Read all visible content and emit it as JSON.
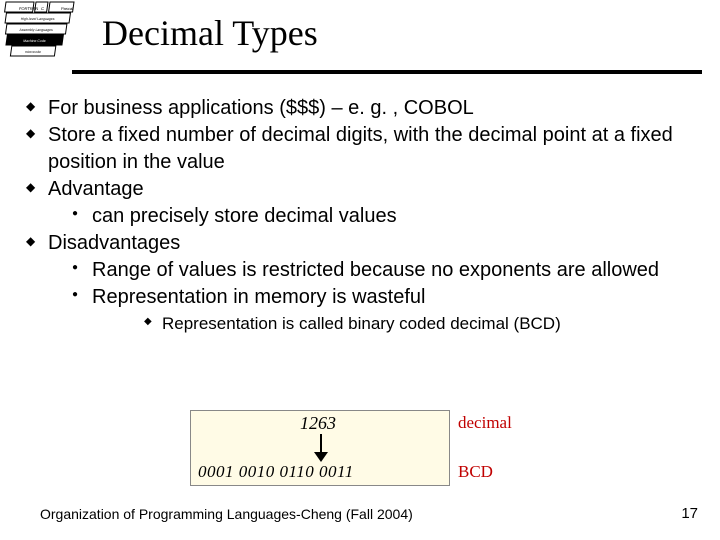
{
  "title": "Decimal Types",
  "bullets": {
    "b1": "For business applications ($$$) – e. g. , COBOL",
    "b2": " Store a fixed number of decimal digits, with the decimal point at a fixed position in the value",
    "b3": "Advantage",
    "b3_1": "can precisely store decimal values",
    "b4": "Disadvantages",
    "b4_1": "Range of values is restricted because no exponents are allowed",
    "b4_2": "Representation in memory is wasteful",
    "b4_2_1": "Representation is called binary coded decimal (BCD)"
  },
  "diagram": {
    "decimal_number": "1263",
    "label_decimal": "decimal",
    "binary_groups": "0001 0010 0110 0011",
    "label_bcd": "BCD"
  },
  "logo_layers": {
    "l0": "FORTRAN",
    "l1a": "C",
    "l1b": "Pascal",
    "l2": "High-level Languages",
    "l3": "Assembly Languages",
    "l4": "Machine Code",
    "l5": "microcode"
  },
  "footer": "Organization of Programming Languages-Cheng (Fall 2004)",
  "page": "17"
}
